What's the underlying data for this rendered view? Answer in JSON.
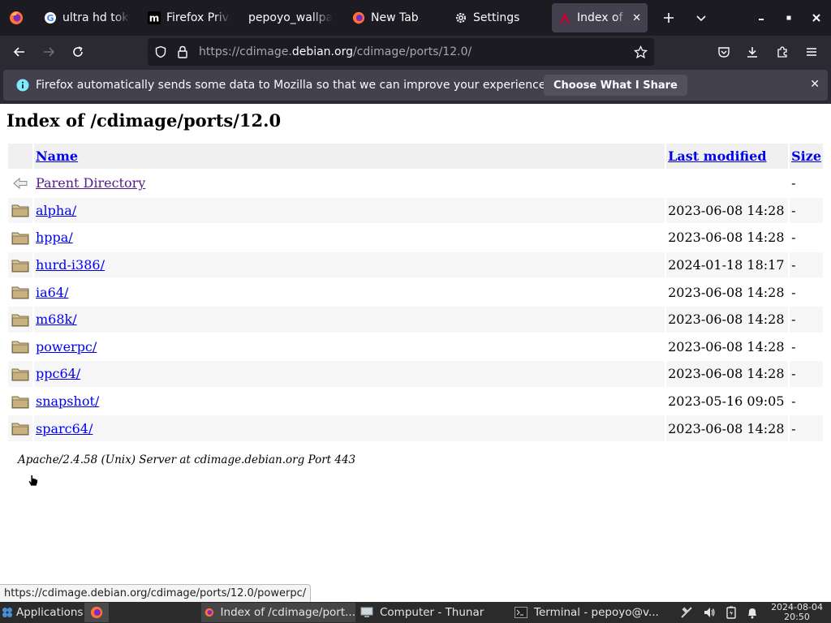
{
  "browser": {
    "tabs": [
      {
        "label": "ultra hd toky",
        "icon": "google-icon",
        "active": false
      },
      {
        "label": "Firefox Priva",
        "icon": "medium-icon",
        "active": false
      },
      {
        "label": "pepoyo_wallpa",
        "icon": "",
        "active": false
      },
      {
        "label": "New Tab",
        "icon": "firefox-icon",
        "active": false
      },
      {
        "label": "Settings",
        "icon": "gear-icon",
        "active": false
      },
      {
        "label": "Index of /c",
        "icon": "debian-favicon",
        "active": true
      }
    ],
    "url": {
      "prefix": "https://cdimage.",
      "domain": "debian.org",
      "path": "/cdimage/ports/12.0/"
    }
  },
  "notification": {
    "message": "Firefox automatically sends some data to Mozilla so that we can improve your experience.",
    "button": "Choose What I Share"
  },
  "page": {
    "title": "Index of /cdimage/ports/12.0",
    "columns": {
      "name": "Name",
      "modified": "Last modified",
      "size": "Size"
    },
    "parent": {
      "name": "Parent Directory",
      "size": "-"
    },
    "rows": [
      {
        "name": "alpha/",
        "modified": "2023-06-08 14:28",
        "size": "-"
      },
      {
        "name": "hppa/",
        "modified": "2023-06-08 14:28",
        "size": "-"
      },
      {
        "name": "hurd-i386/",
        "modified": "2024-01-18 18:17",
        "size": "-"
      },
      {
        "name": "ia64/",
        "modified": "2023-06-08 14:28",
        "size": "-"
      },
      {
        "name": "m68k/",
        "modified": "2023-06-08 14:28",
        "size": "-"
      },
      {
        "name": "powerpc/",
        "modified": "2023-06-08 14:28",
        "size": "-"
      },
      {
        "name": "ppc64/",
        "modified": "2023-06-08 14:28",
        "size": "-"
      },
      {
        "name": "snapshot/",
        "modified": "2023-05-16 09:05",
        "size": "-"
      },
      {
        "name": "sparc64/",
        "modified": "2023-06-08 14:28",
        "size": "-"
      }
    ],
    "footer": "Apache/2.4.58 (Unix) Server at cdimage.debian.org Port 443"
  },
  "status_link": "https://cdimage.debian.org/cdimage/ports/12.0/powerpc/",
  "taskbar": {
    "applications": "Applications",
    "tasks": [
      {
        "label": "Index of /cdimage/port...",
        "icon": "firefox-icon",
        "active": true
      },
      {
        "label": "Computer - Thunar",
        "icon": "file-manager-icon",
        "active": false
      },
      {
        "label": "Terminal - pepoyo@v...",
        "icon": "terminal-icon",
        "active": false
      }
    ],
    "date": "2024-08-04",
    "time": "20:50"
  },
  "colors": {
    "tabbar": "#1c1b22",
    "toolbar": "#2b2a33",
    "link": "#0000ee",
    "visited_link": "#551a8b",
    "taskbar": "#2b2b2b"
  }
}
